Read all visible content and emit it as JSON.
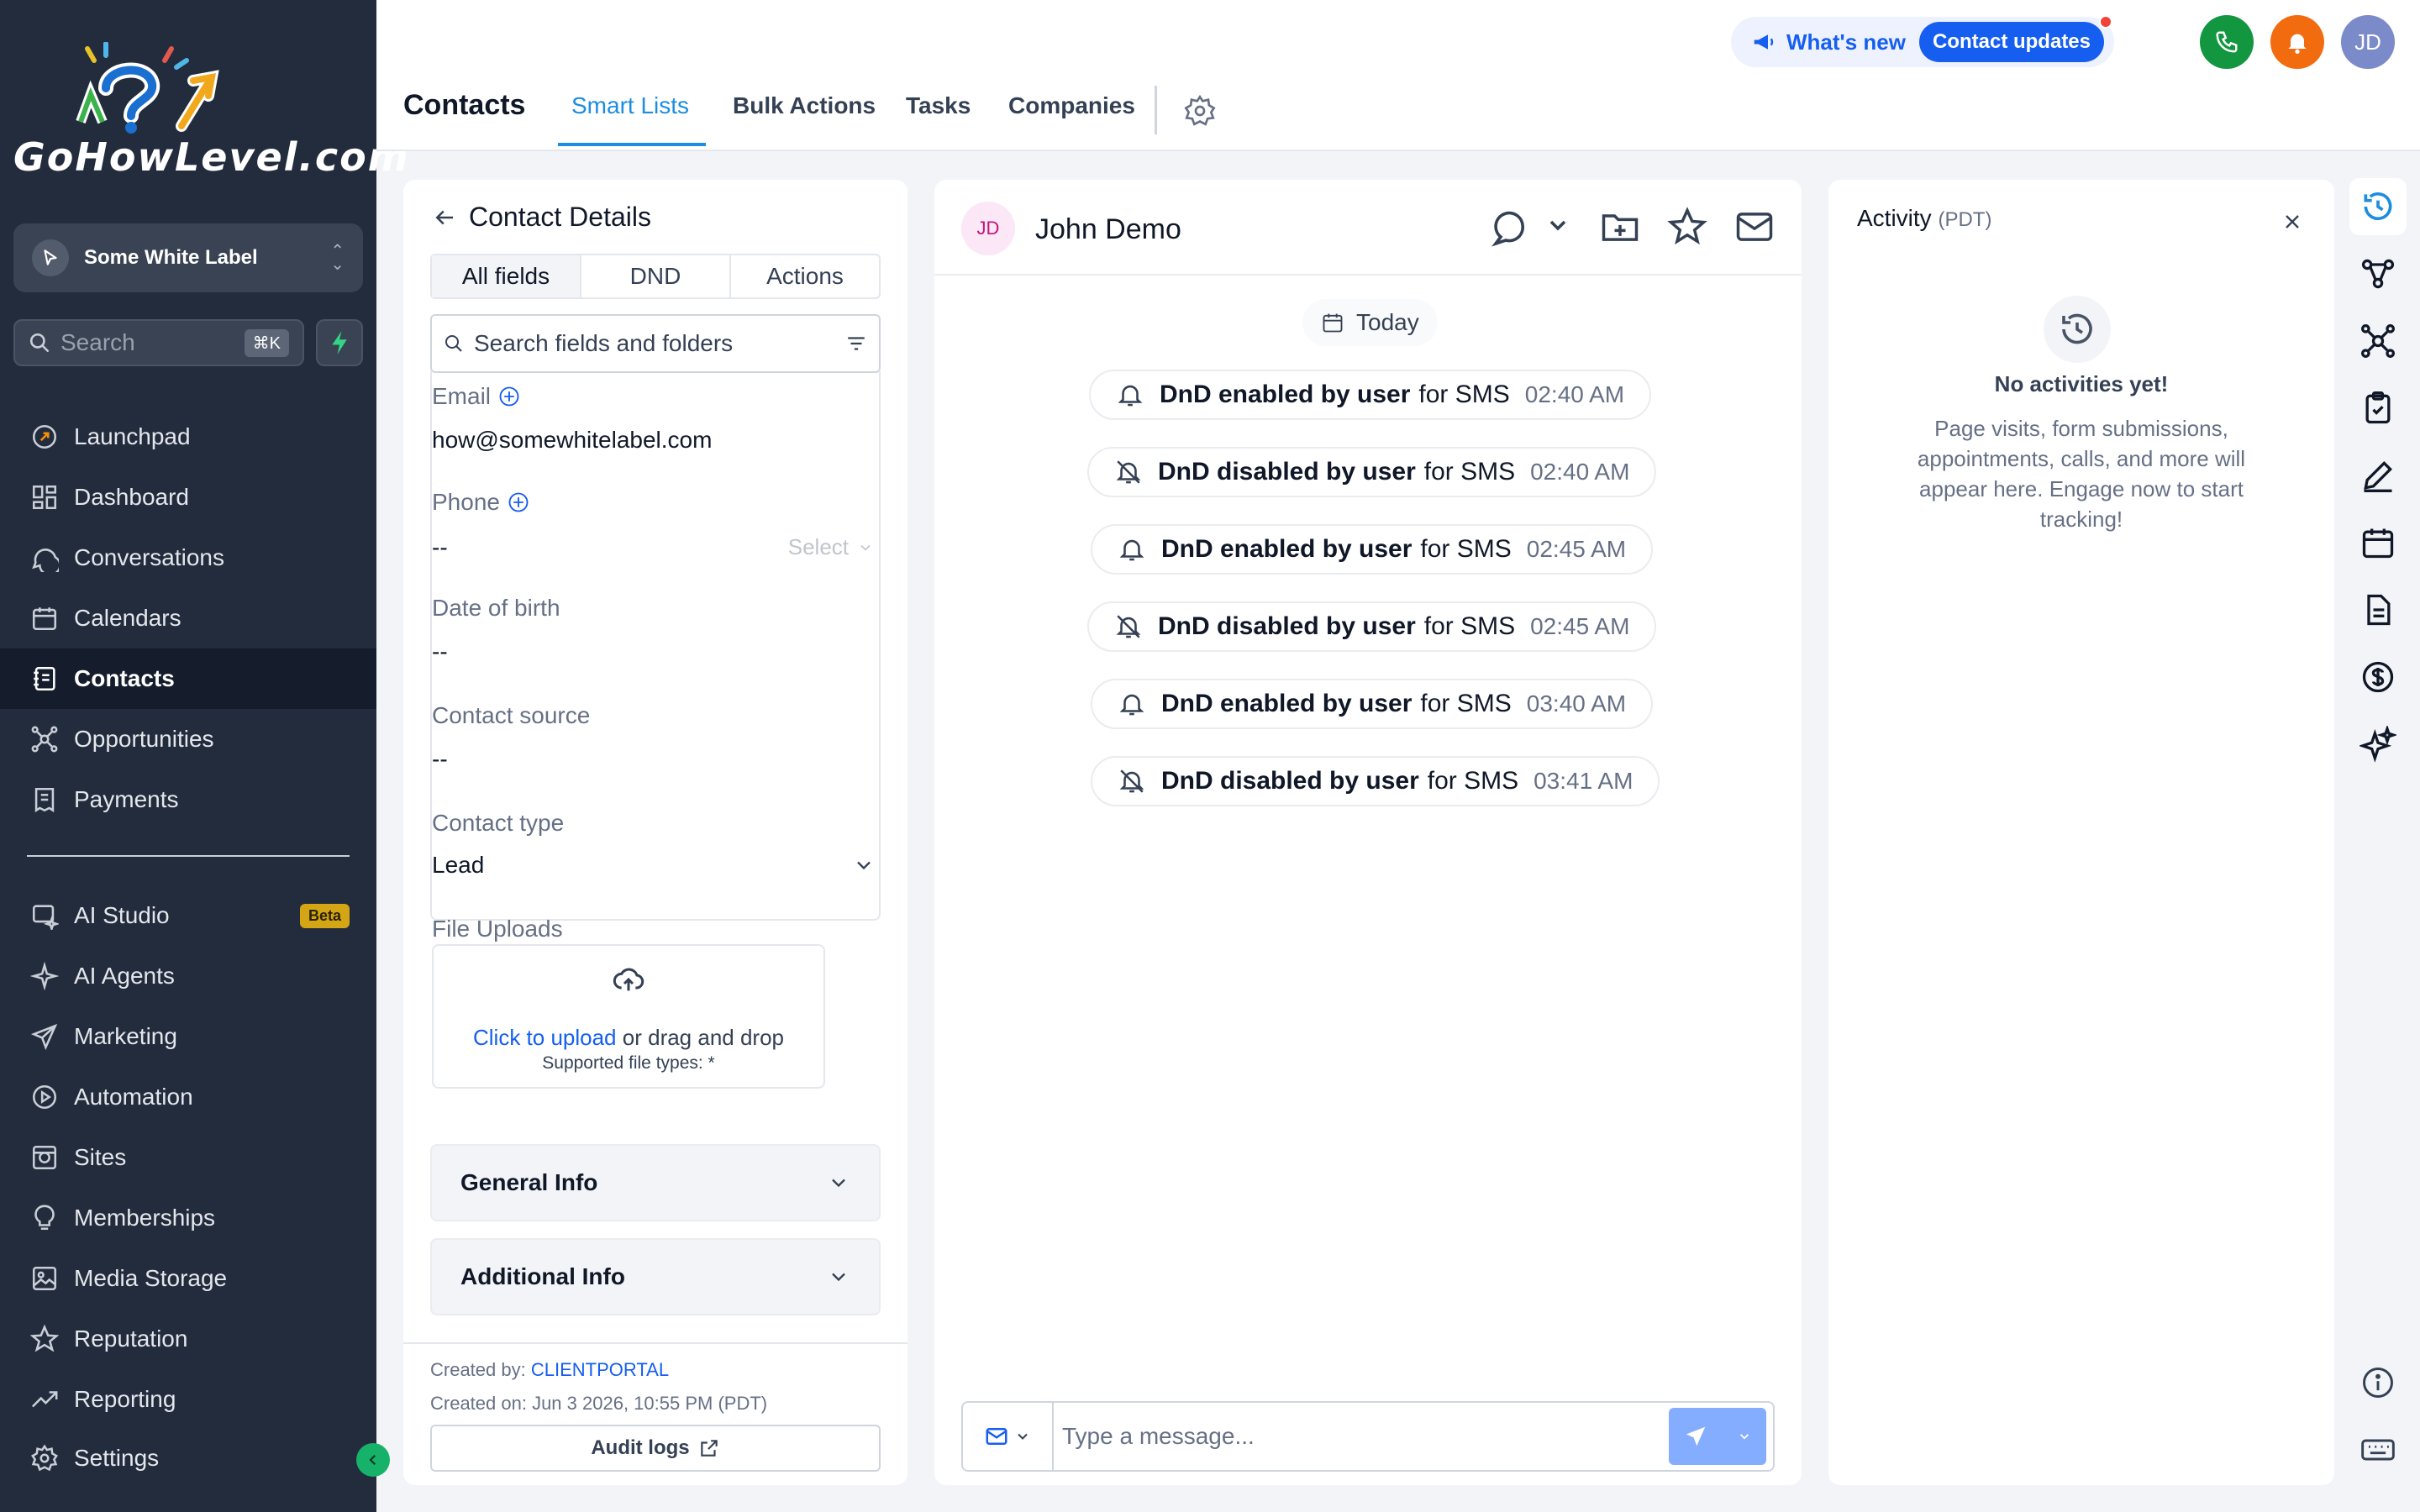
{
  "brand": {
    "logo_text": "GoHowLevel.com"
  },
  "sidebar": {
    "workspace": "Some White Label",
    "search_placeholder": "Search",
    "search_shortcut": "⌘K",
    "items": [
      {
        "label": "Launchpad",
        "icon": "rocket-icon"
      },
      {
        "label": "Dashboard",
        "icon": "grid-icon"
      },
      {
        "label": "Conversations",
        "icon": "chat-icon"
      },
      {
        "label": "Calendars",
        "icon": "calendar-icon"
      },
      {
        "label": "Contacts",
        "icon": "contacts-icon",
        "active": true
      },
      {
        "label": "Opportunities",
        "icon": "funnel-icon"
      },
      {
        "label": "Payments",
        "icon": "receipt-icon"
      }
    ],
    "items2": [
      {
        "label": "AI Studio",
        "icon": "ai-studio-icon",
        "badge": "Beta"
      },
      {
        "label": "AI Agents",
        "icon": "sparkle-icon"
      },
      {
        "label": "Marketing",
        "icon": "send-icon"
      },
      {
        "label": "Automation",
        "icon": "play-circle-icon"
      },
      {
        "label": "Sites",
        "icon": "globe-icon"
      },
      {
        "label": "Memberships",
        "icon": "bulb-icon"
      },
      {
        "label": "Media Storage",
        "icon": "image-icon"
      },
      {
        "label": "Reputation",
        "icon": "star-icon"
      },
      {
        "label": "Reporting",
        "icon": "trend-icon"
      },
      {
        "label": "Settings",
        "icon": "gear-icon"
      }
    ]
  },
  "header": {
    "title": "Contacts",
    "tabs": [
      "Smart Lists",
      "Bulk Actions",
      "Tasks",
      "Companies"
    ],
    "active_tab": "Smart Lists",
    "whats_new": "What's new",
    "contact_updates": "Contact updates",
    "user_initials": "JD"
  },
  "details": {
    "title": "Contact Details",
    "segments": [
      "All fields",
      "DND",
      "Actions"
    ],
    "search_placeholder": "Search fields and folders",
    "email_label": "Email",
    "email_value": "how@somewhitelabel.com",
    "phone_label": "Phone",
    "phone_value": "--",
    "phone_select": "Select",
    "dob_label": "Date of birth",
    "dob_value": "--",
    "source_label": "Contact source",
    "source_value": "--",
    "type_label": "Contact type",
    "type_value": "Lead",
    "uploads_label": "File Uploads",
    "upload_link": "Click to upload",
    "upload_rest": "or drag and drop",
    "upload_types": "Supported file types: *",
    "general_info": "General Info",
    "additional_info": "Additional Info",
    "created_by_label": "Created by:",
    "created_by": "CLIENTPORTAL",
    "created_on": "Created on: Jun 3 2026, 10:55 PM (PDT)",
    "audit_logs": "Audit logs"
  },
  "conversation": {
    "initials": "JD",
    "name": "John Demo",
    "date_label": "Today",
    "events": [
      {
        "bold": "DnD enabled by user",
        "rest": "for SMS",
        "time": "02:40 AM",
        "icon": "bell-icon"
      },
      {
        "bold": "DnD disabled by user",
        "rest": "for SMS",
        "time": "02:40 AM",
        "icon": "bell-off-icon"
      },
      {
        "bold": "DnD enabled by user",
        "rest": "for SMS",
        "time": "02:45 AM",
        "icon": "bell-icon"
      },
      {
        "bold": "DnD disabled by user",
        "rest": "for SMS",
        "time": "02:45 AM",
        "icon": "bell-off-icon"
      },
      {
        "bold": "DnD enabled by user",
        "rest": "for SMS",
        "time": "03:40 AM",
        "icon": "bell-icon"
      },
      {
        "bold": "DnD disabled by user",
        "rest": "for SMS",
        "time": "03:41 AM",
        "icon": "bell-off-icon"
      }
    ],
    "composer_placeholder": "Type a message..."
  },
  "activity": {
    "title": "Activity",
    "tz": "(PDT)",
    "empty_title": "No activities yet!",
    "empty_text": "Page visits, form submissions, appointments, calls, and more will appear here. Engage now to start tracking!"
  },
  "colors": {
    "sidebar_bg": "#232c3d",
    "accent": "#1c8de0",
    "primary": "#155eef",
    "phone_green": "#12963f",
    "bell_orange": "#f26b0f",
    "avatar_purple": "#7b8ac9"
  }
}
